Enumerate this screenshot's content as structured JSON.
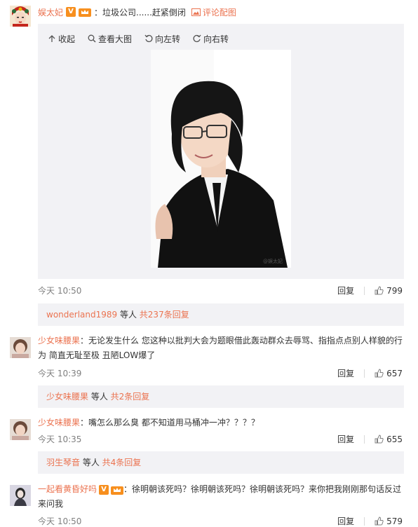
{
  "post": {
    "username": "娱太妃",
    "text": "：垃圾公司......赶紧倒闭",
    "comment_image_link": "评论配图",
    "toolbar": {
      "collapse": "收起",
      "view_large": "查看大图",
      "rotate_left": "向左转",
      "rotate_right": "向右转"
    },
    "watermark": "@娱太妃",
    "time": "今天 10:50",
    "reply_label": "回复",
    "likes": "799",
    "replies_user": "wonderland1989",
    "replies_middle": " 等人 ",
    "replies_count": "共237条回复"
  },
  "comments": [
    {
      "username": "少女味腰果",
      "text_line1": "：无论发生什么 您这种以批判大会为题眼借此轰动群众去辱骂、指指点点别人样貌的行",
      "text_line2": "为 简直无耻至极 丑陋LOW爆了",
      "time": "今天 10:39",
      "reply_label": "回复",
      "likes": "657",
      "replies_user": "少女味腰果",
      "replies_middle": " 等人 ",
      "replies_count": "共2条回复"
    },
    {
      "username": "少女味腰果",
      "text_line1": "：嘴怎么那么臭 都不知道用马桶冲一冲？？？？",
      "time": "今天 10:35",
      "reply_label": "回复",
      "likes": "655",
      "replies_user": "羽生琴音",
      "replies_middle": " 等人 ",
      "replies_count": "共4条回复"
    },
    {
      "username": "一起看黄昏好吗",
      "text_line1": "：徐明朝该死吗？徐明朝该死吗？徐明朝该死吗？来你把我刚刚那句话反过",
      "text_line2": "来问我",
      "time": "今天 10:50",
      "reply_label": "回复",
      "likes": "579"
    }
  ],
  "colors": {
    "link": "#eb7350",
    "panel": "#f2f2f5",
    "vip": "#f78f1e"
  },
  "icons": [
    "collapse-icon",
    "zoom-icon",
    "rotate-left-icon",
    "rotate-right-icon",
    "like-icon",
    "v-badge-icon",
    "crown-icon",
    "image-icon"
  ]
}
